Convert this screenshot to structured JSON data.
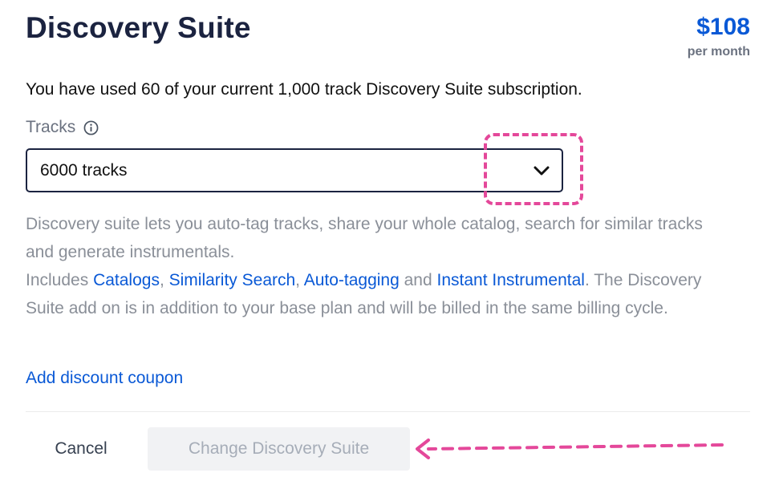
{
  "header": {
    "title": "Discovery Suite",
    "price": "$108",
    "price_period": "per month"
  },
  "usage_text": "You have used 60 of your current 1,000 track Discovery Suite subscription.",
  "tracks": {
    "label": "Tracks",
    "selected": "6000 tracks",
    "info_icon": "info-icon",
    "chevron_icon": "chevron-down-icon"
  },
  "description": {
    "line1": "Discovery suite lets you auto-tag tracks, share your whole catalog, search for similar tracks and generate instrumentals.",
    "includes_prefix": "Includes ",
    "links": [
      "Catalogs",
      "Similarity Search",
      "Auto-tagging",
      "Instant Instrumental"
    ],
    "sep_comma": ", ",
    "sep_and": " and ",
    "suffix": ". The Discovery Suite add on is in addition to your base plan and will be billed in the same billing cycle."
  },
  "coupon_link": "Add discount coupon",
  "footer": {
    "cancel_label": "Cancel",
    "submit_label": "Change Discovery Suite",
    "submit_disabled": true
  },
  "colors": {
    "accent": "#0a59d6",
    "title": "#1b2340",
    "annotation": "#e4489a",
    "muted_text": "#8a8f98"
  }
}
